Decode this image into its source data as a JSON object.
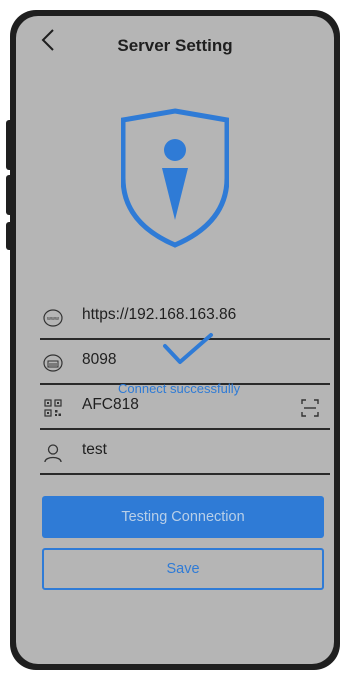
{
  "header": {
    "title": "Server Setting",
    "back_icon": "chevron-left-icon"
  },
  "logo": {
    "icon": "shield-info-icon",
    "color": "#2f7bd6"
  },
  "form": {
    "server_url": {
      "icon": "www-icon",
      "value": "https://192.168.163.86"
    },
    "port": {
      "icon": "port-icon",
      "value": "8098"
    },
    "code": {
      "icon": "qr-code-icon",
      "value": "AFC818",
      "scan_icon": "scan-icon"
    },
    "user": {
      "icon": "user-icon",
      "value": "test"
    }
  },
  "toast": {
    "icon": "checkmark-icon",
    "message": "Connect successfully"
  },
  "actions": {
    "test_label": "Testing Connection",
    "save_label": "Save"
  },
  "colors": {
    "accent": "#2f7bd6",
    "screen_bg": "#b5b5b5",
    "frame": "#1f1f1f"
  }
}
